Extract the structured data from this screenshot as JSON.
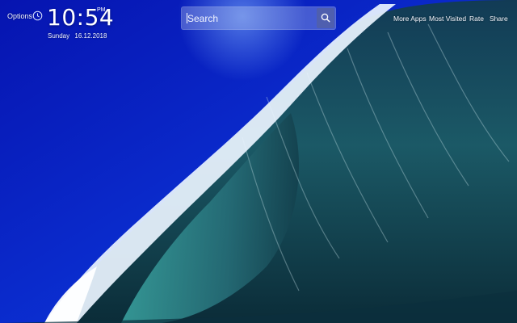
{
  "header": {
    "options_label": "Options",
    "time": "10:54",
    "ampm": "PM",
    "date_day": "Sunday",
    "date_value": "16.12.2018"
  },
  "search": {
    "placeholder": "Search"
  },
  "nav": {
    "more_apps": "More Apps",
    "most_visited": "Most Visited",
    "rate": "Rate",
    "share": "Share"
  },
  "icons": {
    "clock": "clock-icon",
    "search": "search-icon"
  },
  "colors": {
    "sky": "#0a1fb8",
    "wave_dark": "#0b3a44",
    "wave_teal": "#2f8a8a",
    "foam": "#e8f3ff"
  }
}
